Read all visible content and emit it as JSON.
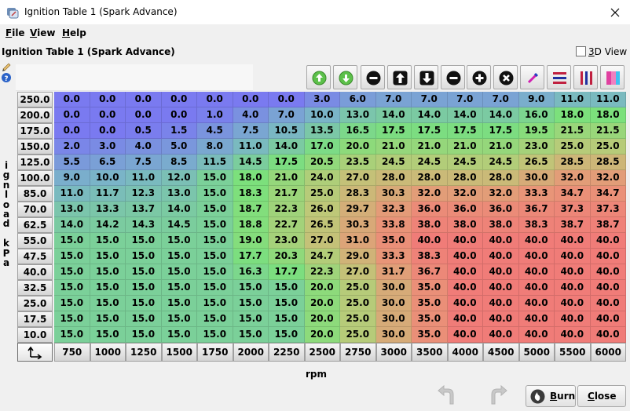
{
  "window": {
    "title": "Ignition Table 1 (Spark Advance)"
  },
  "menu": [
    {
      "label": "File",
      "mnemonic": "F",
      "rest": "ile"
    },
    {
      "label": "View",
      "mnemonic": "V",
      "rest": "iew"
    },
    {
      "label": "Help",
      "mnemonic": "H",
      "rest": "elp"
    }
  ],
  "panel": {
    "title": "Ignition Table 1 (Spark Advance)"
  },
  "view3d": {
    "mnemonic": "3",
    "rest": "D View",
    "checked": false
  },
  "toolbar": [
    {
      "name": "increment-coarse-button",
      "icon": "green-arrow-up-icon"
    },
    {
      "name": "decrement-coarse-button",
      "icon": "green-arrow-down-icon"
    },
    {
      "name": "decrease-button",
      "icon": "minus-circle-icon"
    },
    {
      "name": "shift-up-button",
      "icon": "arrow-up-box-icon"
    },
    {
      "name": "shift-down-button",
      "icon": "arrow-down-box-icon"
    },
    {
      "name": "subtract-button",
      "icon": "minus-circle-icon"
    },
    {
      "name": "add-button",
      "icon": "plus-circle-icon"
    },
    {
      "name": "clear-button",
      "icon": "x-circle-icon"
    },
    {
      "name": "interpolate-button",
      "icon": "pencil-icon"
    },
    {
      "name": "horizontal-smooth-button",
      "icon": "horizontal-bars-icon"
    },
    {
      "name": "vertical-smooth-button",
      "icon": "vertical-bars-icon"
    },
    {
      "name": "color-scale-button",
      "icon": "gradient-icon"
    }
  ],
  "y_axis": {
    "label": "ignload kPa",
    "letters": [
      "i",
      "g",
      "n",
      "l",
      "o",
      "a",
      "d",
      "",
      "k",
      "P",
      "a"
    ]
  },
  "x_axis": {
    "label": "rpm"
  },
  "rows": [
    "250.0",
    "200.0",
    "175.0",
    "150.0",
    "125.0",
    "100.0",
    "85.0",
    "70.0",
    "62.5",
    "55.0",
    "47.5",
    "40.0",
    "32.5",
    "25.0",
    "17.5",
    "10.0"
  ],
  "columns": [
    "750",
    "1000",
    "1250",
    "1500",
    "1750",
    "2000",
    "2250",
    "2500",
    "2750",
    "3000",
    "3500",
    "4000",
    "4500",
    "5000",
    "5500",
    "6000"
  ],
  "table": [
    [
      "0.0",
      "0.0",
      "0.0",
      "0.0",
      "0.0",
      "0.0",
      "0.0",
      "3.0",
      "6.0",
      "7.0",
      "7.0",
      "7.0",
      "7.0",
      "9.0",
      "11.0",
      "11.0"
    ],
    [
      "0.0",
      "0.0",
      "0.0",
      "0.0",
      "1.0",
      "4.0",
      "7.0",
      "10.0",
      "13.0",
      "14.0",
      "14.0",
      "14.0",
      "14.0",
      "16.0",
      "18.0",
      "18.0"
    ],
    [
      "0.0",
      "0.0",
      "0.5",
      "1.5",
      "4.5",
      "7.5",
      "10.5",
      "13.5",
      "16.5",
      "17.5",
      "17.5",
      "17.5",
      "17.5",
      "19.5",
      "21.5",
      "21.5"
    ],
    [
      "2.0",
      "3.0",
      "4.0",
      "5.0",
      "8.0",
      "11.0",
      "14.0",
      "17.0",
      "20.0",
      "21.0",
      "21.0",
      "21.0",
      "21.0",
      "23.0",
      "25.0",
      "25.0"
    ],
    [
      "5.5",
      "6.5",
      "7.5",
      "8.5",
      "11.5",
      "14.5",
      "17.5",
      "20.5",
      "23.5",
      "24.5",
      "24.5",
      "24.5",
      "24.5",
      "26.5",
      "28.5",
      "28.5"
    ],
    [
      "9.0",
      "10.0",
      "11.0",
      "12.0",
      "15.0",
      "18.0",
      "21.0",
      "24.0",
      "27.0",
      "28.0",
      "28.0",
      "28.0",
      "28.0",
      "30.0",
      "32.0",
      "32.0"
    ],
    [
      "11.0",
      "11.7",
      "12.3",
      "13.0",
      "15.0",
      "18.3",
      "21.7",
      "25.0",
      "28.3",
      "30.3",
      "32.0",
      "32.0",
      "32.0",
      "33.3",
      "34.7",
      "34.7"
    ],
    [
      "13.0",
      "13.3",
      "13.7",
      "14.0",
      "15.0",
      "18.7",
      "22.3",
      "26.0",
      "29.7",
      "32.3",
      "36.0",
      "36.0",
      "36.0",
      "36.7",
      "37.3",
      "37.3"
    ],
    [
      "14.0",
      "14.2",
      "14.3",
      "14.5",
      "15.0",
      "18.8",
      "22.7",
      "26.5",
      "30.3",
      "33.8",
      "38.0",
      "38.0",
      "38.0",
      "38.3",
      "38.7",
      "38.7"
    ],
    [
      "15.0",
      "15.0",
      "15.0",
      "15.0",
      "15.0",
      "19.0",
      "23.0",
      "27.0",
      "31.0",
      "35.0",
      "40.0",
      "40.0",
      "40.0",
      "40.0",
      "40.0",
      "40.0"
    ],
    [
      "15.0",
      "15.0",
      "15.0",
      "15.0",
      "15.0",
      "17.7",
      "20.3",
      "24.7",
      "29.0",
      "33.3",
      "38.3",
      "40.0",
      "40.0",
      "40.0",
      "40.0",
      "40.0"
    ],
    [
      "15.0",
      "15.0",
      "15.0",
      "15.0",
      "15.0",
      "16.3",
      "17.7",
      "22.3",
      "27.0",
      "31.7",
      "36.7",
      "40.0",
      "40.0",
      "40.0",
      "40.0",
      "40.0"
    ],
    [
      "15.0",
      "15.0",
      "15.0",
      "15.0",
      "15.0",
      "15.0",
      "15.0",
      "20.0",
      "25.0",
      "30.0",
      "35.0",
      "40.0",
      "40.0",
      "40.0",
      "40.0",
      "40.0"
    ],
    [
      "15.0",
      "15.0",
      "15.0",
      "15.0",
      "15.0",
      "15.0",
      "15.0",
      "20.0",
      "25.0",
      "30.0",
      "35.0",
      "40.0",
      "40.0",
      "40.0",
      "40.0",
      "40.0"
    ],
    [
      "15.0",
      "15.0",
      "15.0",
      "15.0",
      "15.0",
      "15.0",
      "15.0",
      "20.0",
      "25.0",
      "30.0",
      "35.0",
      "40.0",
      "40.0",
      "40.0",
      "40.0",
      "40.0"
    ],
    [
      "15.0",
      "15.0",
      "15.0",
      "15.0",
      "15.0",
      "15.0",
      "15.0",
      "20.0",
      "25.0",
      "30.0",
      "35.0",
      "40.0",
      "40.0",
      "40.0",
      "40.0",
      "40.0"
    ]
  ],
  "buttons": {
    "burn": {
      "mnemonic": "B",
      "rest": "urn"
    },
    "close": {
      "mnemonic": "C",
      "rest": "lose"
    }
  },
  "colors": {
    "low": "#7878f0",
    "mid": "#7ce07c",
    "high": "#f07c78"
  }
}
